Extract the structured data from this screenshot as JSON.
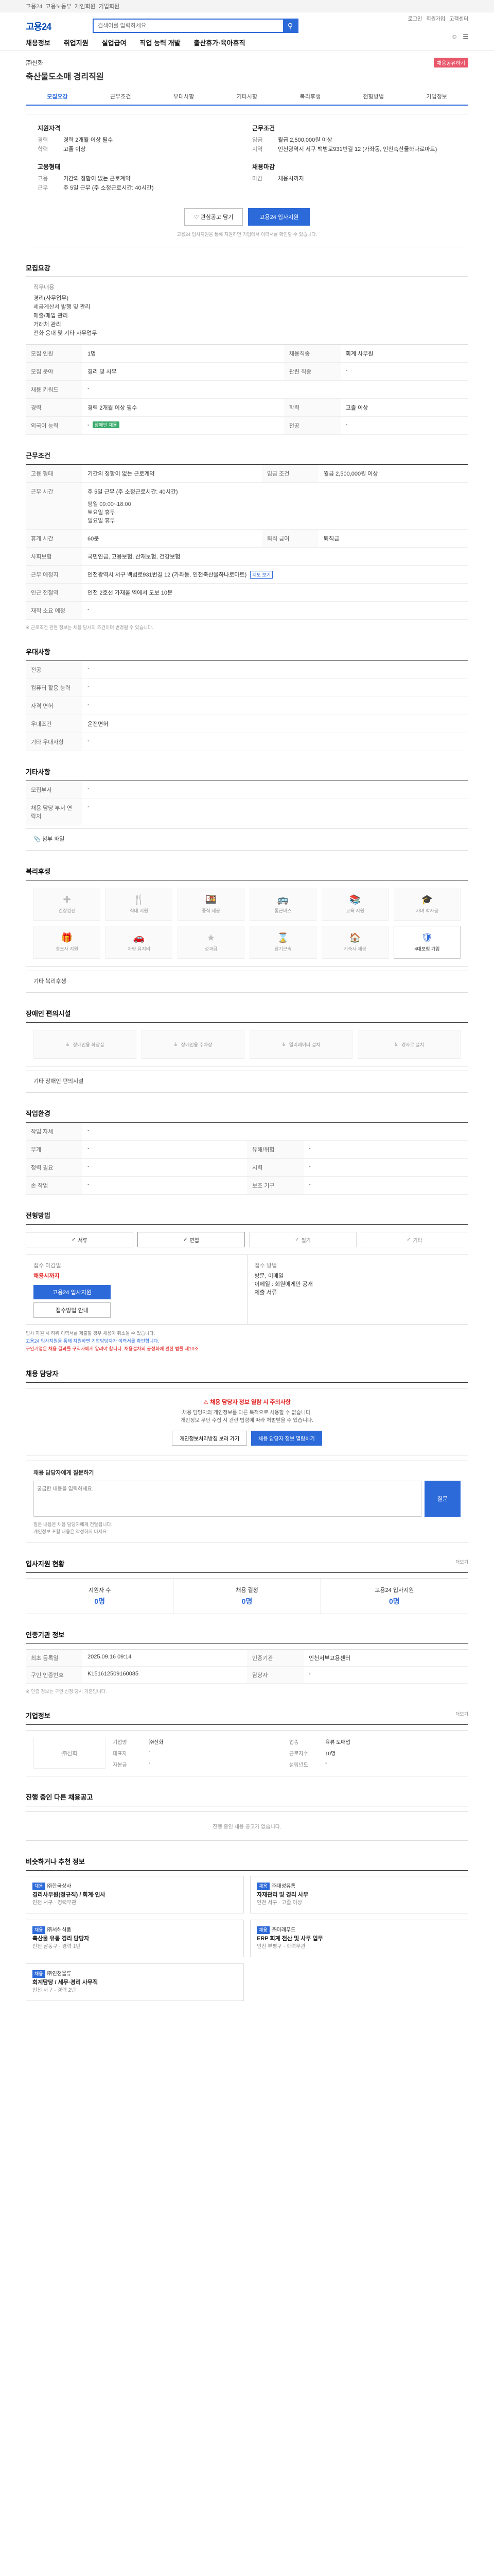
{
  "topbar": {
    "items": [
      "고용24",
      "고용노동부",
      "개인회원",
      "기업회원"
    ]
  },
  "header": {
    "logo": "고용24",
    "search_placeholder": "검색어를 입력하세요",
    "links": [
      "로그인",
      "회원가입",
      "고객센터"
    ],
    "gnb": [
      "채용정보",
      "취업지원",
      "실업급여",
      "직업 능력 개발",
      "출산휴가·육아휴직"
    ]
  },
  "job": {
    "company": "㈜신화",
    "title": "축산물도소매 경리직원",
    "share_label": "채용공유하기"
  },
  "tabs": [
    "모집요강",
    "근무조건",
    "우대사항",
    "기타사항",
    "복리후생",
    "전형방법",
    "기업정보"
  ],
  "summary": {
    "left_head": "지원자격",
    "left": [
      {
        "k": "경력",
        "v": "경력 2개월 이상 필수"
      },
      {
        "k": "학력",
        "v": "고졸 이상"
      }
    ],
    "right_head": "근무조건",
    "right": [
      {
        "k": "임금",
        "v": "월급 2,500,000원 이상"
      },
      {
        "k": "지역",
        "v": "인천광역시 서구 백범로931번길 12 (가좌동, 인천축산물하나로마트)"
      }
    ],
    "left2_head": "고용형태",
    "left2": [
      {
        "k": "고용",
        "v": "기간의 정함이 없는 근로계약"
      },
      {
        "k": "근무",
        "v": "주 5일 근무 (주 소정근로시간: 40시간)"
      }
    ],
    "right2_head": "채용마감",
    "right2": [
      {
        "k": "마감",
        "v": "채용시까지"
      }
    ],
    "btn_scrap": "관심공고 담기",
    "btn_apply": "고용24 입사지원",
    "note": "고용24 입사지원을 통해 지원하면 기업에서 이력서를 확인할 수 있습니다."
  },
  "recruit": {
    "title": "모집요강",
    "duty_label": "직무내용",
    "duty_lines": [
      "경리(사무업무)",
      "세금계산서 발행 및 관리",
      "매출/매입 관리",
      "거래처 관리",
      "전화 응대 및 기타 사무업무"
    ],
    "rows": [
      {
        "h": "모집 인원",
        "v": "1명",
        "h2": "채용직종",
        "v2": "회계 사무원"
      },
      {
        "h": "모집 분야",
        "v": "경리 및 사무",
        "h2": "관련 직종",
        "v2": "-"
      },
      {
        "h": "채용 키워드",
        "v": "-",
        "h2": "",
        "v2": ""
      },
      {
        "h": "경력",
        "v": "경력 2개월 이상 필수",
        "h2": "학력",
        "v2": "고졸 이상"
      },
      {
        "h": "외국어 능력",
        "v": "-",
        "h2": "전공",
        "v2": "-"
      }
    ],
    "badge": "장애인 채용"
  },
  "work": {
    "title": "근무조건",
    "rows": [
      {
        "h": "고용 형태",
        "v": "기간의 정함이 없는 근로계약",
        "h2": "임금 조건",
        "v2": "월급 2,500,000원 이상"
      },
      {
        "h": "근무 시간",
        "v": "주 5일 근무 (주 소정근로시간: 40시간)",
        "h2": "",
        "v2": ""
      },
      {
        "h": "휴게 시간",
        "v": "60분",
        "h2": "퇴직 급여",
        "v2": "퇴직금"
      },
      {
        "h": "사회보험",
        "v": "국민연금, 고용보험, 산재보험, 건강보험",
        "h2": "",
        "v2": ""
      },
      {
        "h": "근무 예정지",
        "v": "인천광역시 서구 백범로931번길 12 (가좌동, 인천축산물하나로마트)",
        "h2": "",
        "v2": ""
      },
      {
        "h": "인근 전철역",
        "v": "인천 2호선 가재울 역에서 도보 10분",
        "h2": "",
        "v2": ""
      },
      {
        "h": "재직 소요 예정",
        "v": "-",
        "h2": "",
        "v2": ""
      }
    ],
    "time_detail": [
      "평일 09:00~18:00",
      "토요일 휴무",
      "일요일 휴무"
    ],
    "map_label": "지도 보기",
    "note": "※ 근로조건 관련 정보는 채용 당시의 조건이며 변경될 수 있습니다."
  },
  "pref": {
    "title": "우대사항",
    "rows": [
      {
        "h": "전공",
        "v": "-"
      },
      {
        "h": "컴퓨터 활용 능력",
        "v": "-"
      },
      {
        "h": "자격 면허",
        "v": "-"
      },
      {
        "h": "우대조건",
        "v": "운전면허"
      },
      {
        "h": "기타 우대사항",
        "v": "-"
      }
    ]
  },
  "etc": {
    "title": "기타사항",
    "rows": [
      {
        "h": "모집부서",
        "v": "-"
      },
      {
        "h": "채용 담당 부서 연락처",
        "v": "-"
      }
    ],
    "attach_label": "첨부 파일"
  },
  "welfare": {
    "title": "복리후생",
    "items": [
      "건강검진",
      "식대 지원",
      "중식 제공",
      "통근버스",
      "교육 지원",
      "자녀 학자금",
      "경조사 지원",
      "차량 유지비",
      "성과급",
      "장기근속",
      "기숙사 제공",
      "4대보험 가입"
    ],
    "active": [
      11
    ],
    "etc_label": "기타 복리후생"
  },
  "disabled": {
    "title": "장애인 편의시설",
    "items": [
      "장애인용 화장실",
      "장애인용 주차장",
      "엘리베이터 설치",
      "경사로 설치"
    ],
    "etc_label": "기타 장애인 편의시설"
  },
  "env": {
    "title": "작업환경",
    "rows": [
      {
        "h": "작업 자세",
        "v": "-",
        "h2": "",
        "v2": ""
      },
      {
        "h": "무게",
        "v": "-",
        "h2": "유해/위험",
        "v2": "-"
      },
      {
        "h": "청력 필요",
        "v": "-",
        "h2": "시력",
        "v2": "-"
      },
      {
        "h": "손 작업",
        "v": "-",
        "h2": "보조 기구",
        "v2": "-"
      }
    ]
  },
  "select": {
    "title": "전형방법",
    "methods": [
      "서류",
      "면접",
      "필기",
      "기타"
    ],
    "active": [
      0,
      1
    ],
    "apply_head": "접수 마감일",
    "deadline": "채용시까지",
    "apply_btn": "고용24 입사지원",
    "apply_btn2": "접수방법 안내",
    "doc_head": "접수 방법",
    "doc_lines": [
      "방문, 이메일",
      "이메일 : 회원에게만 공개",
      "제출 서류"
    ],
    "notes": [
      "입사 지원 시 허위 이력서를 제출할 경우 채용이 취소될 수 있습니다.",
      "고용24 입사지원을 통해 지원하면 기업담당자가 이력서를 확인합니다.",
      "구인기업은 채용 결과를 구직자에게 알려야 합니다. 채용절차의 공정화에 관한 법률 제10조."
    ]
  },
  "contact": {
    "title": "채용 담당자",
    "warn_title": "채용 담당자 정보 열람 시 주의사항",
    "warn_lines": [
      "채용 담당자의 개인정보를 다른 목적으로 사용할 수 없습니다.",
      "개인정보 무단 수집 시 관련 법령에 따라 처벌받을 수 있습니다."
    ],
    "btn1": "개인정보처리방침 보러 가기",
    "btn2": "채용 담당자 정보 열람하기",
    "qa_title": "채용 담당자에게 질문하기",
    "qa_placeholder": "궁금한 내용을 입력하세요.",
    "qa_btn": "질문",
    "qa_notes": [
      "질문 내용은 채용 담당자에게 전달됩니다.",
      "개인정보 포함 내용은 작성하지 마세요."
    ]
  },
  "stats": {
    "title": "입사지원 현황",
    "more": "더보기",
    "items": [
      {
        "label": "지원자 수",
        "num": "0명"
      },
      {
        "label": "채용 결정",
        "num": "0명"
      },
      {
        "label": "고용24 입사지원",
        "num": "0명"
      }
    ]
  },
  "info": {
    "title": "인증기관 정보",
    "rows": [
      {
        "h": "최초 등록일",
        "v": "2025.09.16 09:14",
        "h2": "인증기관",
        "v2": "인천서부고용센터"
      },
      {
        "h": "구인 인증번호",
        "v": "K151612509160085",
        "h2": "담당자",
        "v2": "-"
      }
    ],
    "note": "※ 인증 정보는 구인 신청 당시 기준입니다."
  },
  "corp": {
    "title": "기업정보",
    "more": "더보기",
    "logo": "㈜신화",
    "fields": [
      {
        "h": "기업명",
        "v": "㈜신화"
      },
      {
        "h": "업종",
        "v": "육류 도매업"
      },
      {
        "h": "대표자",
        "v": "-"
      },
      {
        "h": "근로자수",
        "v": "10명"
      },
      {
        "h": "자본금",
        "v": "-"
      },
      {
        "h": "설립년도",
        "v": "-"
      }
    ]
  },
  "others": {
    "title": "진행 중인 다른 채용공고",
    "empty": "진행 중인 채용 공고가 없습니다."
  },
  "recommend": {
    "title": "비슷하거나 추천 정보",
    "jobs": [
      {
        "tag": "채용",
        "company": "㈜한국상사",
        "title": "경리사무원(정규직) / 회계·인사",
        "meta": "인천 서구 · 경력무관"
      },
      {
        "tag": "채용",
        "company": "㈜대성유통",
        "title": "자재관리 및 경리 사무",
        "meta": "인천 서구 · 고졸 이상"
      },
      {
        "tag": "채용",
        "company": "㈜서해식품",
        "title": "축산물 유통 경리 담당자",
        "meta": "인천 남동구 · 경력 1년"
      },
      {
        "tag": "채용",
        "company": "㈜미래푸드",
        "title": "ERP 회계 전산 및 사무 업무",
        "meta": "인천 부평구 · 학력무관"
      },
      {
        "tag": "채용",
        "company": "㈜인천물류",
        "title": "회계담당 / 세무·경리 사무직",
        "meta": "인천 서구 · 경력 2년"
      }
    ]
  }
}
